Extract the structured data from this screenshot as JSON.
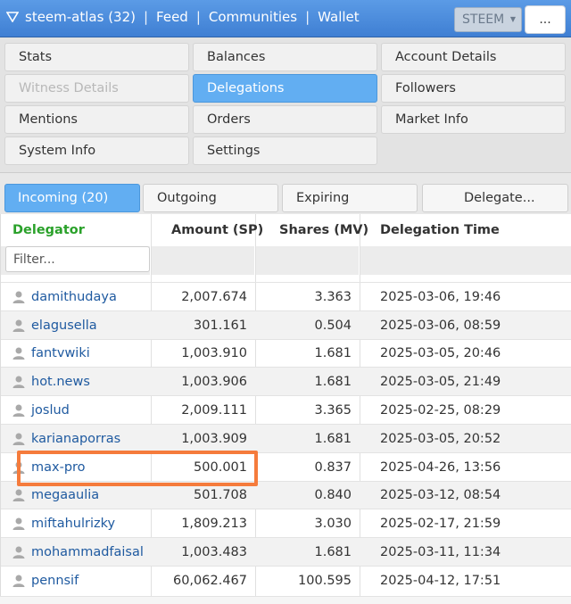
{
  "topbar": {
    "account": "steem-atlas (32)",
    "links": [
      "Feed",
      "Communities",
      "Wallet"
    ],
    "chain": "STEEM",
    "more": "..."
  },
  "menu": {
    "items": [
      {
        "label": "Stats",
        "state": "normal"
      },
      {
        "label": "Balances",
        "state": "normal"
      },
      {
        "label": "Account Details",
        "state": "normal"
      },
      {
        "label": "Witness Details",
        "state": "disabled"
      },
      {
        "label": "Delegations",
        "state": "active"
      },
      {
        "label": "Followers",
        "state": "normal"
      },
      {
        "label": "Mentions",
        "state": "normal"
      },
      {
        "label": "Orders",
        "state": "normal"
      },
      {
        "label": "Market Info",
        "state": "normal"
      },
      {
        "label": "System Info",
        "state": "normal"
      },
      {
        "label": "Settings",
        "state": "normal"
      }
    ]
  },
  "tabs": {
    "incoming": "Incoming (20)",
    "outgoing": "Outgoing",
    "expiring": "Expiring",
    "delegate": "Delegate..."
  },
  "table": {
    "headers": {
      "delegator": "Delegator",
      "amount": "Amount (SP)",
      "shares": "Shares (MV)",
      "time": "Delegation Time"
    },
    "filter_placeholder": "Filter...",
    "rows": [
      {
        "user": "damithudaya",
        "amount": "2,007.674",
        "shares": "3.363",
        "time": "2025-03-06, 19:46"
      },
      {
        "user": "elagusella",
        "amount": "301.161",
        "shares": "0.504",
        "time": "2025-03-06, 08:59"
      },
      {
        "user": "fantvwiki",
        "amount": "1,003.910",
        "shares": "1.681",
        "time": "2025-03-05, 20:46"
      },
      {
        "user": "hot.news",
        "amount": "1,003.906",
        "shares": "1.681",
        "time": "2025-03-05, 21:49"
      },
      {
        "user": "joslud",
        "amount": "2,009.111",
        "shares": "3.365",
        "time": "2025-02-25, 08:29"
      },
      {
        "user": "karianaporras",
        "amount": "1,003.909",
        "shares": "1.681",
        "time": "2025-03-05, 20:52"
      },
      {
        "user": "max-pro",
        "amount": "500.001",
        "shares": "0.837",
        "time": "2025-04-26, 13:56"
      },
      {
        "user": "megaaulia",
        "amount": "501.708",
        "shares": "0.840",
        "time": "2025-03-12, 08:54"
      },
      {
        "user": "miftahulrizky",
        "amount": "1,809.213",
        "shares": "3.030",
        "time": "2025-02-17, 21:59"
      },
      {
        "user": "mohammadfaisal",
        "amount": "1,003.483",
        "shares": "1.681",
        "time": "2025-03-11, 11:34"
      },
      {
        "user": "pennsif",
        "amount": "60,062.467",
        "shares": "100.595",
        "time": "2025-04-12, 17:51"
      }
    ]
  },
  "colors": {
    "topbar": "#4a8ce0",
    "active": "#62aef2",
    "delegator_header": "#2aa12a",
    "link": "#1f5aa0",
    "highlight": "#f57b3c"
  }
}
